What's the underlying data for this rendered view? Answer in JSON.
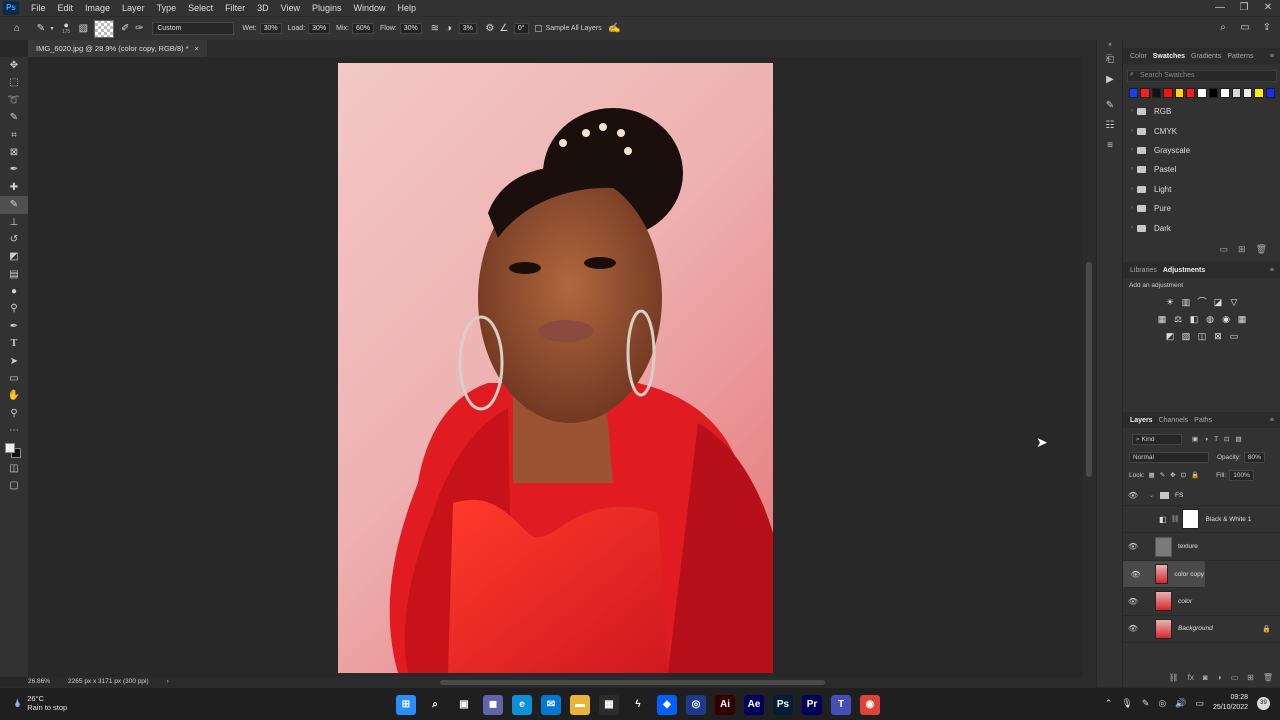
{
  "app": {
    "logo_text": "Ps"
  },
  "menu": [
    "File",
    "Edit",
    "Image",
    "Layer",
    "Type",
    "Select",
    "Filter",
    "3D",
    "View",
    "Plugins",
    "Window",
    "Help"
  ],
  "window_controls": [
    "—",
    "❐",
    "✕"
  ],
  "options": {
    "brush_size": "175",
    "preset": "Custom",
    "wet_label": "Wet:",
    "wet": "30%",
    "load_label": "Load:",
    "load": "30%",
    "mix_label": "Mix:",
    "mix": "60%",
    "flow_label": "Flow:",
    "flow": "30%",
    "smoothing": "3%",
    "angle": "0°",
    "sample_all_layers": "Sample All Layers"
  },
  "document": {
    "tab_title": "IMG_6020.jpg @ 28.9% (color copy, RGB/8) *",
    "close": "×"
  },
  "status": {
    "zoom": "26.86%",
    "doc_info": "2265 px x 3171 px (300 ppi)",
    "arrow": "›"
  },
  "panels": {
    "top_tabs": [
      "Color",
      "Swatches",
      "Gradients",
      "Patterns"
    ],
    "active_top_tab": "Swatches",
    "search_placeholder": "Search Swatches",
    "swatch_colors": [
      "#1b3bff",
      "#ff1b1b",
      "#111111",
      "#ff1010",
      "#ffd400",
      "#ff1b1b",
      "#ffffff",
      "#000000",
      "#ffffff",
      "#d8d8d8",
      "#eeeeee",
      "#ffee00",
      "#1b2bff"
    ],
    "swatch_groups": [
      "RGB",
      "CMYK",
      "Grayscale",
      "Pastel",
      "Light",
      "Pure",
      "Dark"
    ],
    "mid_tabs": [
      "Libraries",
      "Adjustments"
    ],
    "active_mid_tab": "Adjustments",
    "add_adjustment": "Add an adjustment",
    "layer_tabs": [
      "Layers",
      "Channels",
      "Paths"
    ],
    "kind_label": "Kind",
    "blend_mode": "Normal",
    "opacity_label": "Opacity:",
    "opacity": "80%",
    "lock_label": "Lock:",
    "fill_label": "Fill:",
    "fill": "100%",
    "layers": [
      {
        "name": "FS",
        "type": "group"
      },
      {
        "name": "Black & White 1",
        "type": "adjustment"
      },
      {
        "name": "texture",
        "type": "gray"
      },
      {
        "name": "color copy",
        "type": "photo",
        "selected": true
      },
      {
        "name": "color",
        "type": "photo"
      },
      {
        "name": "Background",
        "type": "photo",
        "locked": true
      }
    ]
  },
  "taskbar": {
    "temperature": "26°C",
    "weather": "Rain to stop",
    "time": "09:28",
    "date": "25/10/2022",
    "notifications": "39",
    "apps": [
      {
        "name": "start",
        "glyph": "⊞",
        "color": "#2a8cff"
      },
      {
        "name": "search",
        "glyph": "⌕",
        "color": "#1f1f1f"
      },
      {
        "name": "task-view",
        "glyph": "▣",
        "color": "#1f1f1f"
      },
      {
        "name": "teams",
        "glyph": "◼",
        "color": "#6264a7"
      },
      {
        "name": "edge",
        "glyph": "e",
        "color": "#0f8fd8"
      },
      {
        "name": "mail",
        "glyph": "✉",
        "color": "#0078d4"
      },
      {
        "name": "file-explorer",
        "glyph": "▬",
        "color": "#e8b53a"
      },
      {
        "name": "store",
        "glyph": "▦",
        "color": "#2c2c2c"
      },
      {
        "name": "winamp",
        "glyph": "ϟ",
        "color": "#1f1f1f"
      },
      {
        "name": "dropbox",
        "glyph": "◆",
        "color": "#0061ff"
      },
      {
        "name": "app-blue",
        "glyph": "◎",
        "color": "#1e3a8a"
      },
      {
        "name": "illustrator",
        "glyph": "Ai",
        "color": "#330000"
      },
      {
        "name": "after-effects",
        "glyph": "Ae",
        "color": "#00005b"
      },
      {
        "name": "photoshop",
        "glyph": "Ps",
        "color": "#001e36"
      },
      {
        "name": "premiere",
        "glyph": "Pr",
        "color": "#00005b"
      },
      {
        "name": "teams-2",
        "glyph": "T",
        "color": "#464eb8"
      },
      {
        "name": "chrome",
        "glyph": "◉",
        "color": "#db4437"
      }
    ]
  }
}
